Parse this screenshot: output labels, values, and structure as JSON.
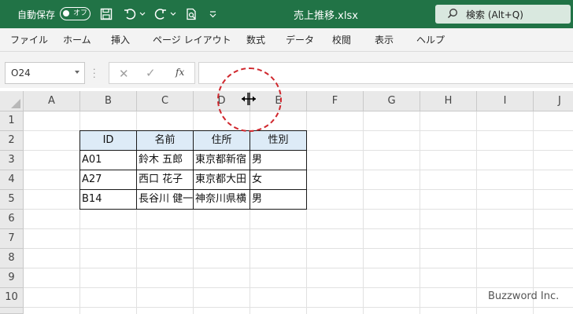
{
  "titlebar": {
    "autosave_label": "自動保存",
    "toggle_state": "オフ",
    "doc_title": "売上推移.xlsx",
    "search_placeholder": "検索 (Alt+Q)",
    "bg_color": "#217346"
  },
  "ribbon": {
    "tabs": [
      "ファイル",
      "ホーム",
      "挿入",
      "ページ レイアウト",
      "数式",
      "データ",
      "校閲",
      "表示",
      "ヘルプ"
    ]
  },
  "formula_bar": {
    "name_box": "O24",
    "fx_label": "fx",
    "formula": ""
  },
  "sheet": {
    "columns": [
      "A",
      "B",
      "C",
      "D",
      "E",
      "F",
      "G",
      "H",
      "I",
      "J"
    ],
    "rows": [
      "1",
      "2",
      "3",
      "4",
      "5",
      "6",
      "7",
      "8",
      "9",
      "10"
    ],
    "table": {
      "headers": [
        "ID",
        "名前",
        "住所",
        "性別"
      ],
      "rows": [
        [
          "A01",
          "鈴木 五郎",
          "東京都新宿",
          "男"
        ],
        [
          "A27",
          "西口 花子",
          "東京都大田",
          "女"
        ],
        [
          "B14",
          "長谷川 健一",
          "神奈川県横",
          "男"
        ]
      ],
      "header_fill": "#ddebf7"
    }
  },
  "watermark": "Buzzword Inc.",
  "annotation_color": "#d0282e"
}
